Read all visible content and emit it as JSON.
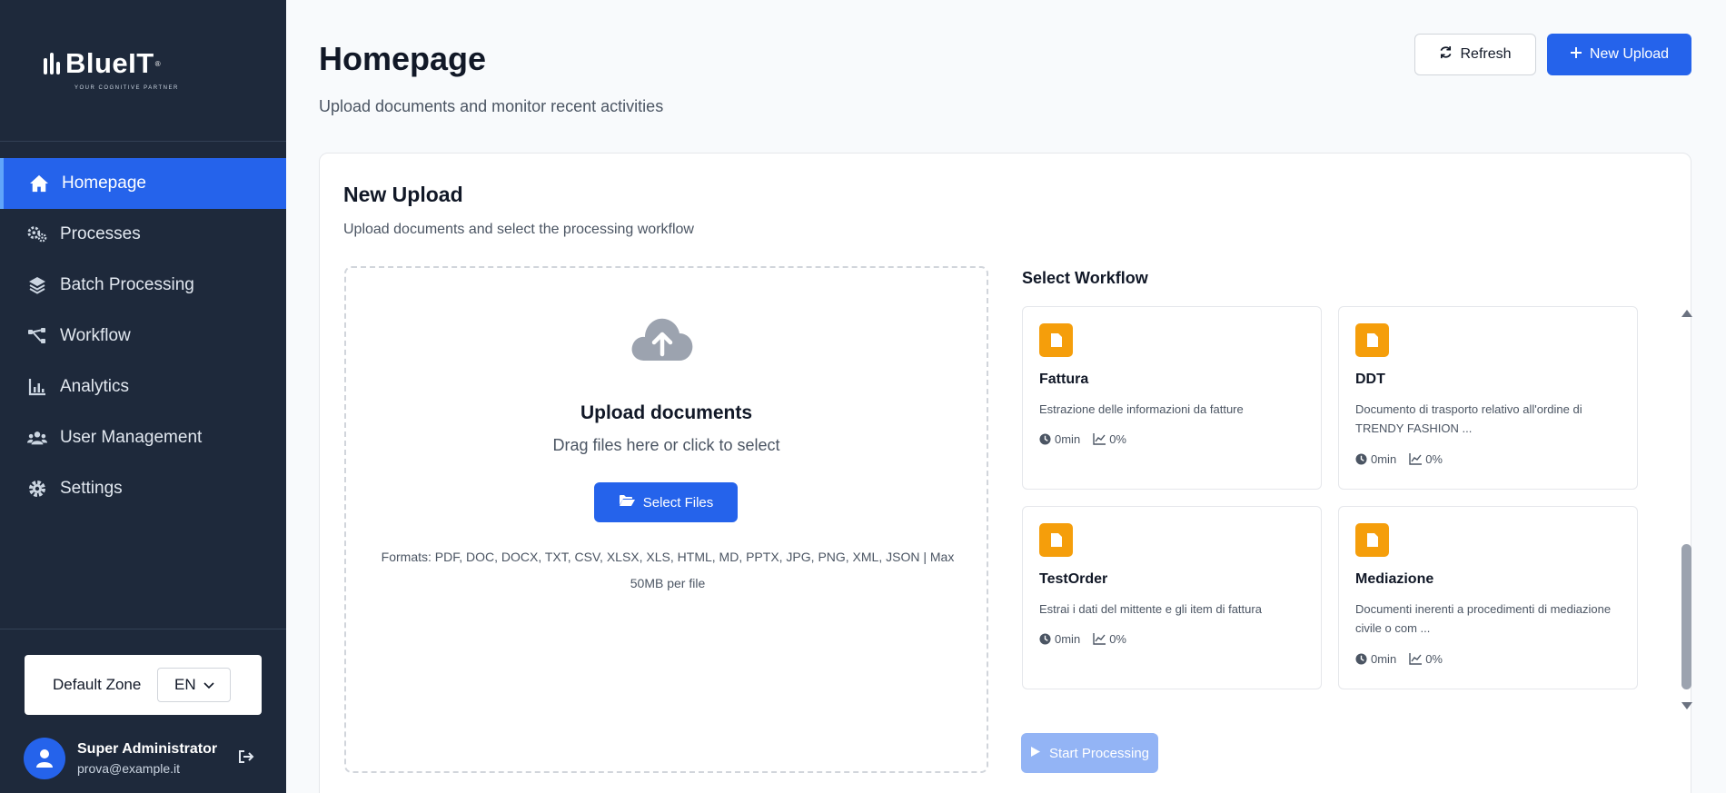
{
  "brand": {
    "name": "BlueIT",
    "reg": "®",
    "tagline": "YOUR COGNITIVE PARTNER"
  },
  "sidebar": {
    "items": [
      {
        "label": "Homepage",
        "icon": "home-icon",
        "active": true
      },
      {
        "label": "Processes",
        "icon": "gears-icon",
        "active": false
      },
      {
        "label": "Batch Processing",
        "icon": "layers-icon",
        "active": false
      },
      {
        "label": "Workflow",
        "icon": "sitemap-icon",
        "active": false
      },
      {
        "label": "Analytics",
        "icon": "chart-icon",
        "active": false
      },
      {
        "label": "User Management",
        "icon": "users-icon",
        "active": false
      },
      {
        "label": "Settings",
        "icon": "gear-icon",
        "active": false
      }
    ],
    "zone_label": "Default Zone",
    "language": "EN",
    "user": {
      "name": "Super Administrator",
      "email": "prova@example.it"
    }
  },
  "header": {
    "title": "Homepage",
    "subtitle": "Upload documents and monitor recent activities",
    "refresh_label": "Refresh",
    "new_upload_label": "New Upload"
  },
  "upload": {
    "title": "New Upload",
    "subtitle": "Upload documents and select the processing workflow",
    "dropzone_title": "Upload documents",
    "dropzone_sub": "Drag files here or click to select",
    "select_label": "Select Files",
    "formats": "Formats: PDF, DOC, DOCX, TXT, CSV, XLSX, XLS, HTML, MD, PPTX, JPG, PNG, XML, JSON | Max 50MB per file"
  },
  "workflow": {
    "title": "Select Workflow",
    "start_label": "Start Processing",
    "items": [
      {
        "name": "Fattura",
        "desc": "Estrazione delle informazioni da fatture",
        "time": "0min",
        "rate": "0%"
      },
      {
        "name": "DDT",
        "desc": "Documento di trasporto relativo all'ordine di TRENDY FASHION ...",
        "time": "0min",
        "rate": "0%"
      },
      {
        "name": "TestOrder",
        "desc": "Estrai i dati del mittente e gli item di fattura",
        "time": "0min",
        "rate": "0%"
      },
      {
        "name": "Mediazione",
        "desc": "Documenti inerenti a procedimenti di mediazione civile o com ...",
        "time": "0min",
        "rate": "0%"
      }
    ]
  },
  "colors": {
    "sidebar_bg": "#1e293b",
    "accent": "#2563eb",
    "badge": "#f59e0b"
  }
}
